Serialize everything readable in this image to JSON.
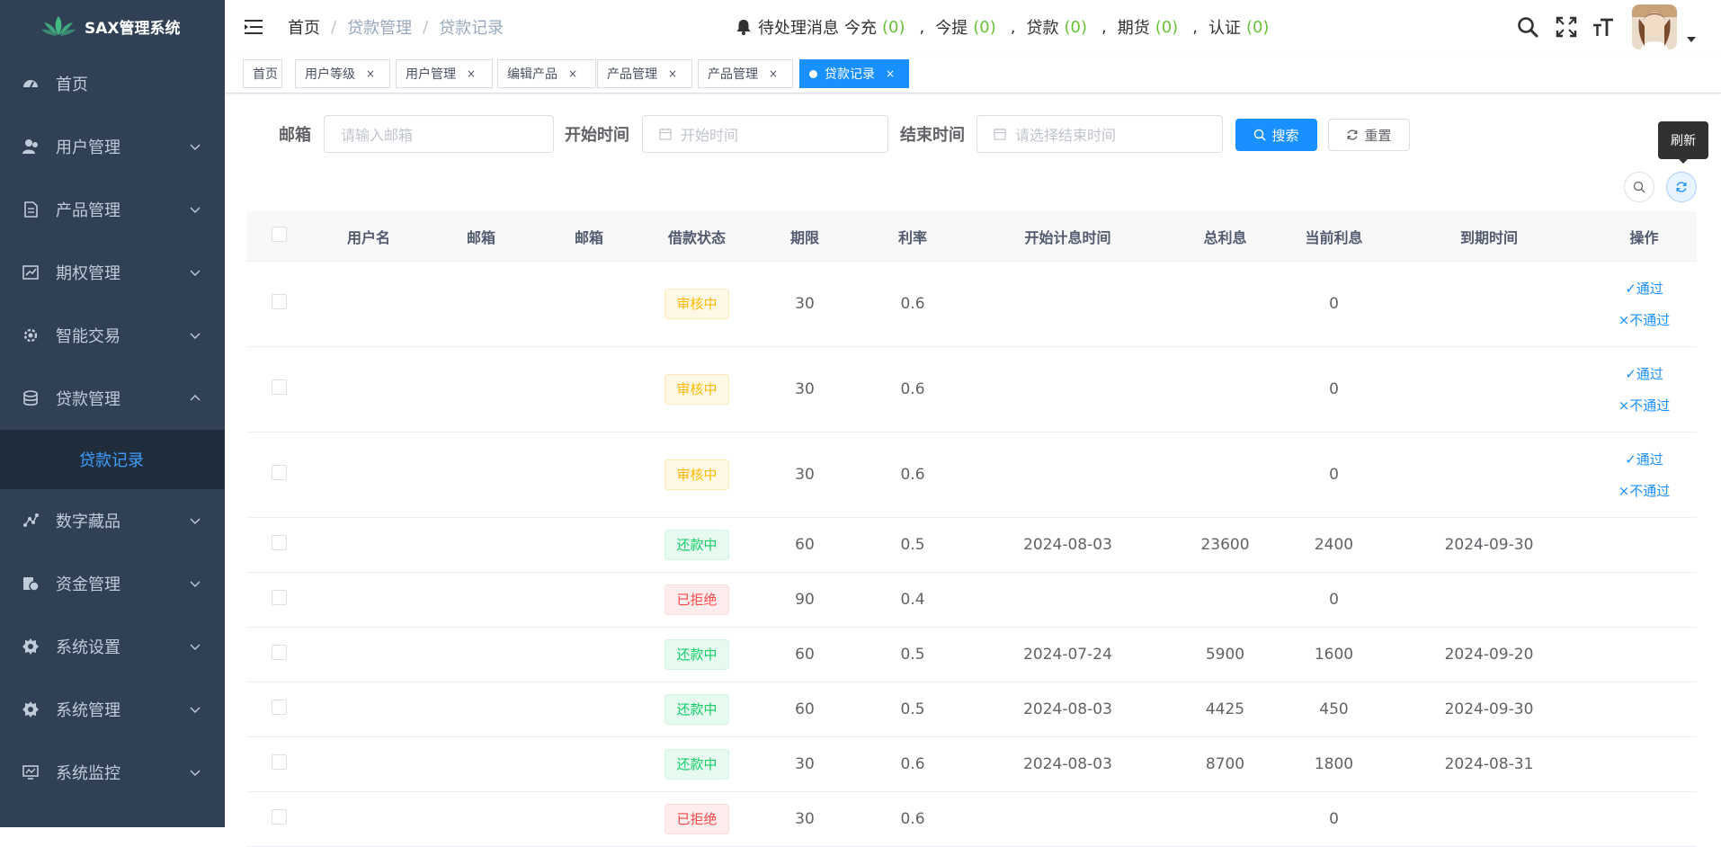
{
  "sidebar": {
    "app_title": "SAX管理系统",
    "items": [
      {
        "label": "首页",
        "icon": "dashboard-icon"
      },
      {
        "label": "用户管理",
        "icon": "user-icon"
      },
      {
        "label": "产品管理",
        "icon": "document-icon"
      },
      {
        "label": "期权管理",
        "icon": "chart-icon"
      },
      {
        "label": "智能交易",
        "icon": "gear-icon"
      },
      {
        "label": "贷款管理",
        "icon": "coins-icon"
      },
      {
        "label": "数字藏品",
        "icon": "graph-icon"
      },
      {
        "label": "资金管理",
        "icon": "money-icon"
      },
      {
        "label": "系统设置",
        "icon": "settings-icon"
      },
      {
        "label": "系统管理",
        "icon": "settings-icon"
      },
      {
        "label": "系统监控",
        "icon": "monitor-icon"
      }
    ],
    "sub_item": "贷款记录"
  },
  "header": {
    "breadcrumb": [
      "首页",
      "贷款管理",
      "贷款记录"
    ],
    "notice_prefix": "待处理消息",
    "notices": [
      {
        "label": "今充",
        "count": "(0)"
      },
      {
        "label": "今提",
        "count": "(0)"
      },
      {
        "label": "贷款",
        "count": "(0)"
      },
      {
        "label": "期货",
        "count": "(0)"
      },
      {
        "label": "认证",
        "count": "(0)"
      }
    ]
  },
  "tags": [
    "首页",
    "用户等级",
    "用户管理",
    "编辑产品",
    "产品管理",
    "产品管理",
    "贷款记录"
  ],
  "tag_close": "×",
  "search": {
    "email_label": "邮箱",
    "email_placeholder": "请输入邮箱",
    "start_label": "开始时间",
    "start_placeholder": "开始时间",
    "end_label": "结束时间",
    "end_placeholder": "请选择结束时间",
    "search_button": "搜索",
    "reset_button": "重置"
  },
  "tooltip": "刷新",
  "table": {
    "columns": [
      "用户名",
      "邮箱",
      "邮箱",
      "借款状态",
      "期限",
      "利率",
      "开始计息时间",
      "总利息",
      "当前利息",
      "到期时间",
      "操作"
    ],
    "approve_label": "✓通过",
    "reject_label": "×不通过",
    "rows": [
      {
        "status": "审核中",
        "status_type": "review",
        "term": "30",
        "rate": "0.6",
        "start": "",
        "total": "",
        "current": "0",
        "due": "",
        "actions": true
      },
      {
        "status": "审核中",
        "status_type": "review",
        "term": "30",
        "rate": "0.6",
        "start": "",
        "total": "",
        "current": "0",
        "due": "",
        "actions": true
      },
      {
        "status": "审核中",
        "status_type": "review",
        "term": "30",
        "rate": "0.6",
        "start": "",
        "total": "",
        "current": "0",
        "due": "",
        "actions": true
      },
      {
        "status": "还款中",
        "status_type": "repay",
        "term": "60",
        "rate": "0.5",
        "start": "2024-08-03",
        "total": "23600",
        "current": "2400",
        "due": "2024-09-30",
        "actions": false
      },
      {
        "status": "已拒绝",
        "status_type": "reject",
        "term": "90",
        "rate": "0.4",
        "start": "",
        "total": "",
        "current": "0",
        "due": "",
        "actions": false
      },
      {
        "status": "还款中",
        "status_type": "repay",
        "term": "60",
        "rate": "0.5",
        "start": "2024-07-24",
        "total": "5900",
        "current": "1600",
        "due": "2024-09-20",
        "actions": false
      },
      {
        "status": "还款中",
        "status_type": "repay",
        "term": "60",
        "rate": "0.5",
        "start": "2024-08-03",
        "total": "4425",
        "current": "450",
        "due": "2024-09-30",
        "actions": false
      },
      {
        "status": "还款中",
        "status_type": "repay",
        "term": "30",
        "rate": "0.6",
        "start": "2024-08-03",
        "total": "8700",
        "current": "1800",
        "due": "2024-08-31",
        "actions": false
      },
      {
        "status": "已拒绝",
        "status_type": "reject",
        "term": "30",
        "rate": "0.6",
        "start": "",
        "total": "",
        "current": "0",
        "due": "",
        "actions": false
      }
    ]
  },
  "colors": {
    "sidebar_bg": "#304156",
    "primary": "#1890ff",
    "success": "#13ce66",
    "warning": "#ffba00",
    "danger": "#ff4949"
  }
}
